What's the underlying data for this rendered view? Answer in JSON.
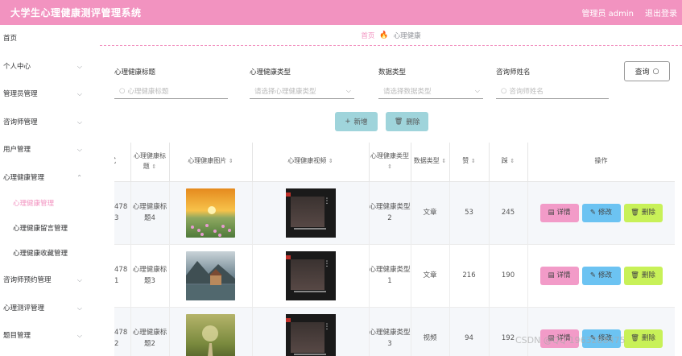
{
  "header": {
    "title": "大学生心理健康测评管理系统",
    "user": "管理员 admin",
    "logout": "退出登录",
    "bg_color": "#f293c0"
  },
  "sidebar": {
    "items": [
      {
        "label": "首页",
        "chevron": false
      },
      {
        "label": "个人中心",
        "chevron": true
      },
      {
        "label": "管理员管理",
        "chevron": true
      },
      {
        "label": "咨询师管理",
        "chevron": true
      },
      {
        "label": "用户管理",
        "chevron": true
      },
      {
        "label": "心理健康管理",
        "chevron": true,
        "expanded": true
      }
    ],
    "sub_items": [
      "心理健康管理",
      "心理健康留言管理",
      "心理健康收藏管理"
    ],
    "items_after": [
      "咨询师预约管理",
      "心理测评管理",
      "题目管理"
    ]
  },
  "breadcrumb": {
    "home": "首页",
    "current": "心理健康"
  },
  "filters": {
    "title_label": "心理健康标题",
    "title_placeholder": "心理健康标题",
    "type_label": "心理健康类型",
    "type_placeholder": "请选择心理健康类型",
    "data_type_label": "数据类型",
    "data_type_placeholder": "请选择数据类型",
    "counselor_label": "咨询师姓名",
    "counselor_placeholder": "咨询师姓名",
    "search_btn": "查询"
  },
  "actions": {
    "add": "新增",
    "delete": "删除"
  },
  "table": {
    "headers": [
      "方式",
      "心理健康标题",
      "心理健康图片",
      "心理健康视频",
      "心理健康类型",
      "数据类型",
      "赞",
      "踩",
      "操作"
    ],
    "rows": [
      {
        "col1": "478 3",
        "title": "心理健康标题4",
        "type": "心理健康类型2",
        "data_type": "文章",
        "likes": "53",
        "dislikes": "245"
      },
      {
        "col1": "478 1",
        "title": "心理健康标题3",
        "type": "心理健康类型1",
        "data_type": "文章",
        "likes": "216",
        "dislikes": "190"
      },
      {
        "col1": "478 2",
        "title": "心理健康标题2",
        "type": "心理健康类型3",
        "data_type": "视频",
        "likes": "94",
        "dislikes": "192"
      }
    ],
    "btn_detail": "详情",
    "btn_edit": "修改",
    "btn_delete": "删除"
  },
  "watermark": "CSDN @QQ 1963288475"
}
